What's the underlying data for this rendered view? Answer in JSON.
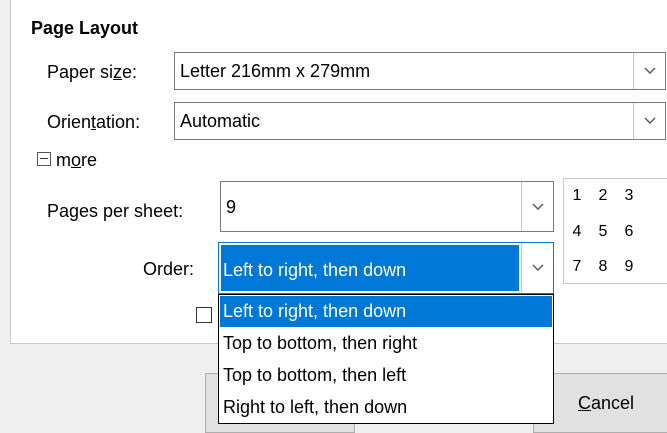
{
  "page_layout": {
    "title": "Page Layout",
    "paper_size": {
      "label_pre": "Paper si",
      "label_u": "z",
      "label_post": "e:",
      "value": "Letter 216mm x 279mm"
    },
    "orientation": {
      "label_pre": "Orien",
      "label_u": "t",
      "label_post": "ation:",
      "value": "Automatic"
    },
    "more": {
      "pre": "m",
      "u": "o",
      "post": "re"
    },
    "pages_per_sheet": {
      "label": "Pages per sheet:",
      "value": "9"
    },
    "order": {
      "label": "Order:",
      "value": "Left to right, then down"
    },
    "preview_numbers": [
      "1",
      "2",
      "3",
      "4",
      "5",
      "6",
      "7",
      "8",
      "9"
    ]
  },
  "order_options": [
    {
      "label": "Left to right, then down",
      "selected": true
    },
    {
      "label": "Top to bottom, then right",
      "selected": false
    },
    {
      "label": "Top to bottom, then left",
      "selected": false
    },
    {
      "label": "Right to left, then down",
      "selected": false
    }
  ],
  "buttons": {
    "cancel_u": "C",
    "cancel_post": "ancel"
  },
  "icons": {
    "dropdown_arrow": "chevron-down-icon",
    "collapse": "collapse-minus-icon"
  },
  "colors": {
    "accent": "#0078d7"
  }
}
